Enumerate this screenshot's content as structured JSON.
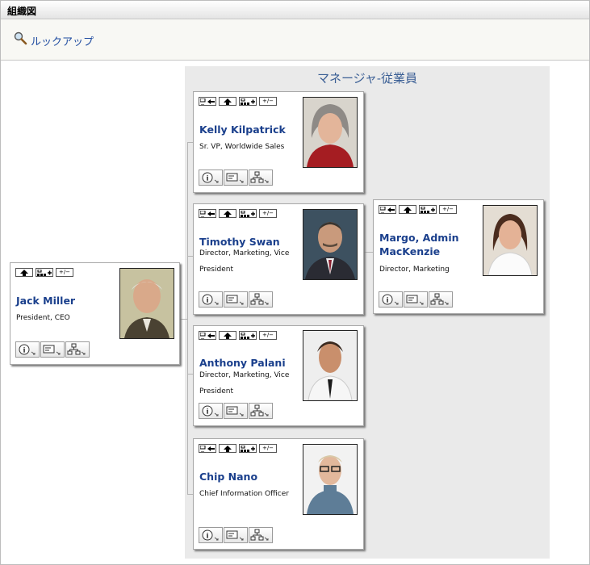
{
  "window": {
    "title": "組織図"
  },
  "toolbar": {
    "lookup_label": "ルックアップ"
  },
  "panel": {
    "title": "マネージャ-従業員"
  },
  "buttons": {
    "move_left": "",
    "up": "",
    "expand": "",
    "toggle": "+/−"
  },
  "colors": {
    "link": "#1a3f8c",
    "panel_bg": "#eaeaea"
  },
  "manager": {
    "name": "Jack Miller",
    "title": "President, CEO"
  },
  "employees": [
    {
      "name": "Kelly Kilpatrick",
      "title": "Sr. VP, Worldwide Sales"
    },
    {
      "name": "Timothy Swan",
      "title": "Director, Marketing, Vice President"
    },
    {
      "name": "Anthony Palani",
      "title": "Director, Marketing, Vice President"
    },
    {
      "name": "Chip Nano",
      "title": "Chief Information Officer"
    }
  ],
  "report": {
    "name": "Margo, Admin MacKenzie",
    "title": "Director, Marketing"
  }
}
